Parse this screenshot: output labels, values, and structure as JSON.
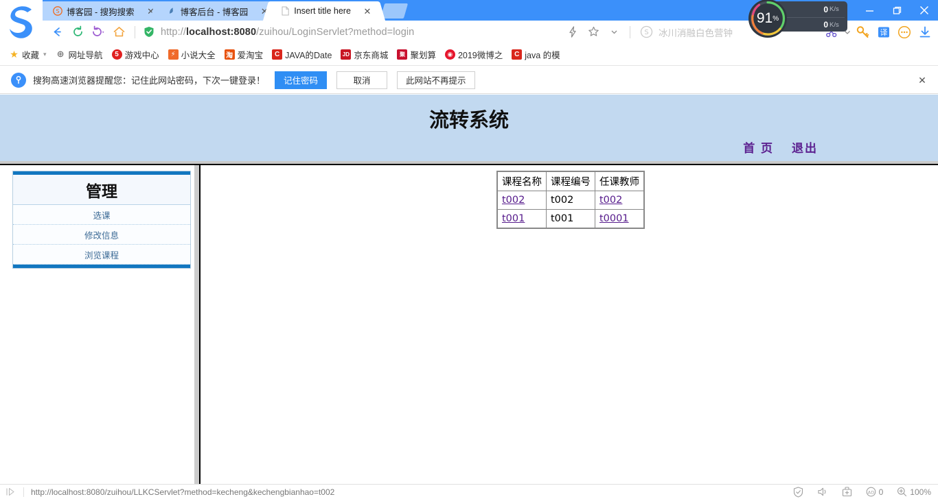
{
  "browser": {
    "tabs": [
      {
        "title": "博客园 - 搜狗搜索",
        "favicon": "sogou-s-icon",
        "active": false
      },
      {
        "title": "博客后台 - 博客园",
        "favicon": "blog-icon",
        "active": false
      },
      {
        "title": "Insert title here",
        "favicon": "page-icon",
        "active": true
      }
    ],
    "new_tab_label": "+",
    "window_controls": {
      "menu": "☰",
      "skin": "skin-icon",
      "minimize": "–",
      "restore": "❐",
      "close": "✕"
    },
    "nav": {
      "back": "←",
      "refresh": "⟳",
      "history": "↺",
      "home": "⌂",
      "url_prefix": "http://",
      "url_host": "localhost:8080",
      "url_path": "/zuihou/LoginServlet?method=login",
      "url_full": "http://localhost:8080/zuihou/LoginServlet?method=login",
      "lightning": "⚡",
      "star": "☆",
      "caret": "▾"
    },
    "search": {
      "engine": "sogou",
      "placeholder": "冰川消融白色营钟"
    },
    "speed": {
      "percent": "91",
      "percent_symbol": "%",
      "upload": "0",
      "upload_unit": "K/s",
      "download": "0",
      "download_unit": "K/s"
    },
    "toolbar_right": [
      {
        "name": "scissors-icon",
        "glyph": "✂"
      },
      {
        "name": "caret-down-icon",
        "glyph": "▾"
      },
      {
        "name": "key-icon",
        "glyph": "🔑"
      },
      {
        "name": "translate-icon",
        "glyph": "译"
      },
      {
        "name": "more-icon",
        "glyph": "⋯"
      },
      {
        "name": "download-icon",
        "glyph": "↓"
      }
    ],
    "bookmarks": {
      "favorites_label": "收藏",
      "items": [
        {
          "label": "网址导航",
          "icon": "globe-icon",
          "color": "#7a7a7a"
        },
        {
          "label": "游戏中心",
          "icon": "game-icon",
          "color": "#e02020"
        },
        {
          "label": "小说大全",
          "icon": "novel-icon",
          "color": "#f06a2a"
        },
        {
          "label": "爱淘宝",
          "icon": "taobao-icon",
          "color": "#e8520f"
        },
        {
          "label": "JAVA的Date",
          "icon": "csdn-icon",
          "color": "#d9261c"
        },
        {
          "label": "京东商城",
          "icon": "jd-icon",
          "color": "#c81623"
        },
        {
          "label": "聚划算",
          "icon": "juhuasuan-icon",
          "color": "#c8102e"
        },
        {
          "label": "2019微博之",
          "icon": "weibo-icon",
          "color": "#e6162d"
        },
        {
          "label": "java 的模",
          "icon": "csdn-icon",
          "color": "#d9261c"
        }
      ]
    },
    "notification": {
      "icon": "key-badge-icon",
      "message": "搜狗高速浏览器提醒您：记住此网站密码，下次一键登录！",
      "buttons": [
        {
          "label": "记住密码",
          "primary": true
        },
        {
          "label": "取消",
          "primary": false
        },
        {
          "label": "此网站不再提示",
          "primary": false
        }
      ],
      "close": "✕"
    },
    "statusbar": {
      "hover_url": "http://localhost:8080/zuihou/LLKCServlet?method=kecheng&kechengbianhao=t002",
      "shield_icon": "shield-icon",
      "sound_icon": "speaker-icon",
      "toolbox_icon": "toolbox-icon",
      "ad_icon": "ad-block-icon",
      "ad_count": "0",
      "zoom_icon": "zoom-icon",
      "zoom_level": "100%"
    }
  },
  "page": {
    "header": {
      "title": "流转系统",
      "nav_links": [
        {
          "label": "首 页"
        },
        {
          "label": "退出"
        }
      ],
      "bg_color": "#c2d9f0"
    },
    "sidebar": {
      "title": "管理",
      "accent_color": "#1277c0",
      "items": [
        {
          "label": "选课"
        },
        {
          "label": "修改信息"
        },
        {
          "label": "浏览课程"
        }
      ]
    },
    "table": {
      "headers": [
        "课程名称",
        "课程编号",
        "任课教师"
      ],
      "rows": [
        {
          "name": "t002",
          "name_link": true,
          "code": "t002",
          "teacher": "t002",
          "teacher_link": true
        },
        {
          "name": "t001",
          "name_link": true,
          "code": "t001",
          "teacher": "t0001",
          "teacher_link": true
        }
      ],
      "link_color": "#551a8b"
    }
  }
}
